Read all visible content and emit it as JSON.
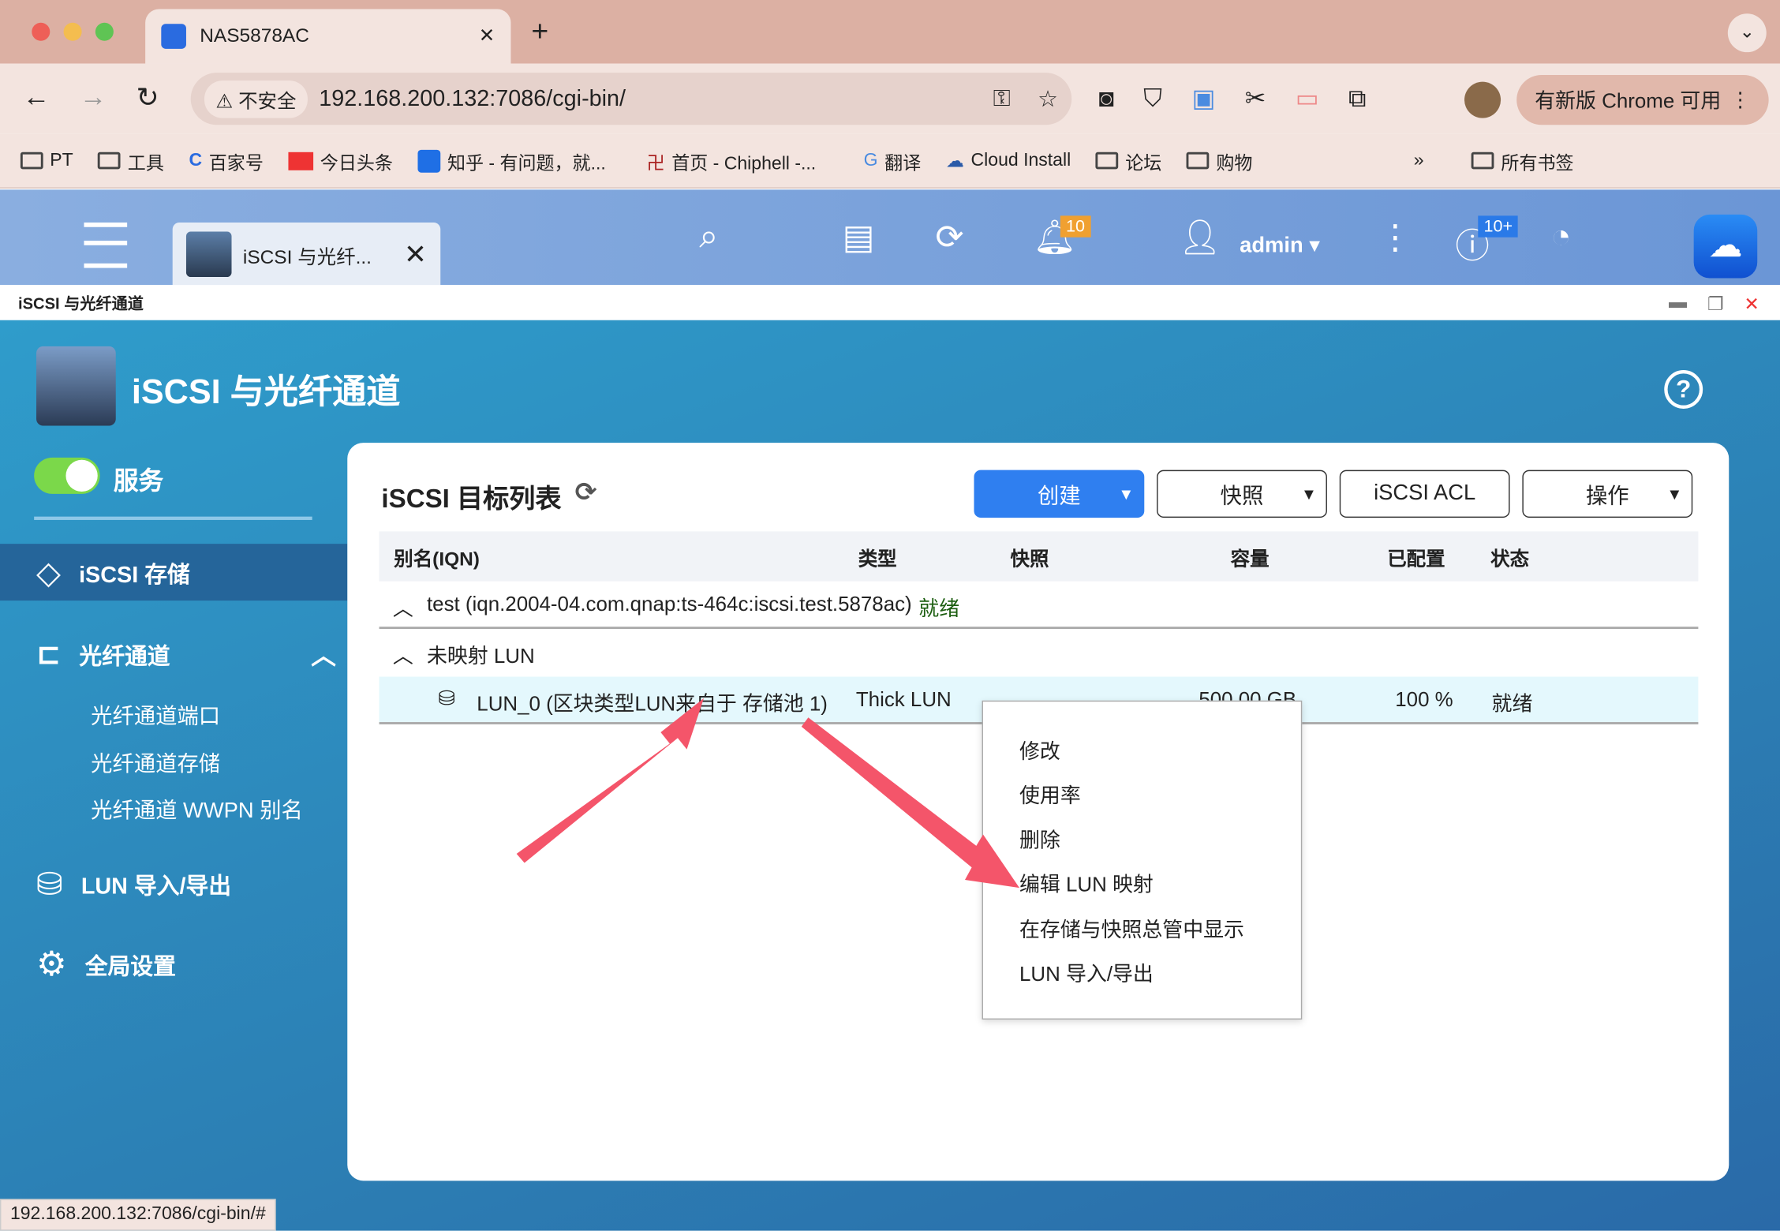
{
  "browser": {
    "tab_title": "NAS5878AC",
    "new_tab": "+",
    "insecure_label": "不安全",
    "url": "192.168.200.132:7086/cgi-bin/",
    "update_button": "有新版 Chrome 可用",
    "bookmarks": [
      "PT",
      "工具",
      "百家号",
      "今日头条",
      "知乎 - 有问题，就...",
      "首页 - Chiphell -...",
      "翻译",
      "Cloud Install",
      "论坛",
      "购物"
    ],
    "more": "»",
    "all_bookmarks": "所有书签"
  },
  "qts": {
    "app_tab": "iSCSI 与光纤...",
    "notif_count": "10",
    "user": "admin",
    "update_count": "10+",
    "window_title": "iSCSI 与光纤通道"
  },
  "app": {
    "title": "iSCSI 与光纤通道",
    "service_label": "服务",
    "nav": {
      "iscsi_storage": "iSCSI 存储",
      "fc": "光纤通道",
      "fc_items": [
        "光纤通道端口",
        "光纤通道存储",
        "光纤通道 WWPN 别名"
      ],
      "lun_io": "LUN 导入/导出",
      "global": "全局设置"
    },
    "panel_title": "iSCSI 目标列表",
    "buttons": {
      "create": "创建",
      "snapshot": "快照",
      "acl": "iSCSI ACL",
      "action": "操作"
    },
    "columns": [
      "别名(IQN)",
      "类型",
      "快照",
      "容量",
      "已配置",
      "状态"
    ],
    "target": {
      "name": "test (iqn.2004-04.com.qnap:ts-464c:iscsi.test.5878ac)",
      "status": "就绪"
    },
    "unmapped": "未映射 LUN",
    "lun": {
      "name": "LUN_0 (区块类型LUN来自于 存储池 1)",
      "type": "Thick LUN",
      "capacity": "500.00 GB",
      "allocated": "100 %",
      "status": "就绪"
    },
    "context_menu": [
      "修改",
      "使用率",
      "删除",
      "编辑 LUN 映射",
      "在存储与快照总管中显示",
      "LUN 导入/导出"
    ]
  },
  "status_url": "192.168.200.132:7086/cgi-bin/#"
}
